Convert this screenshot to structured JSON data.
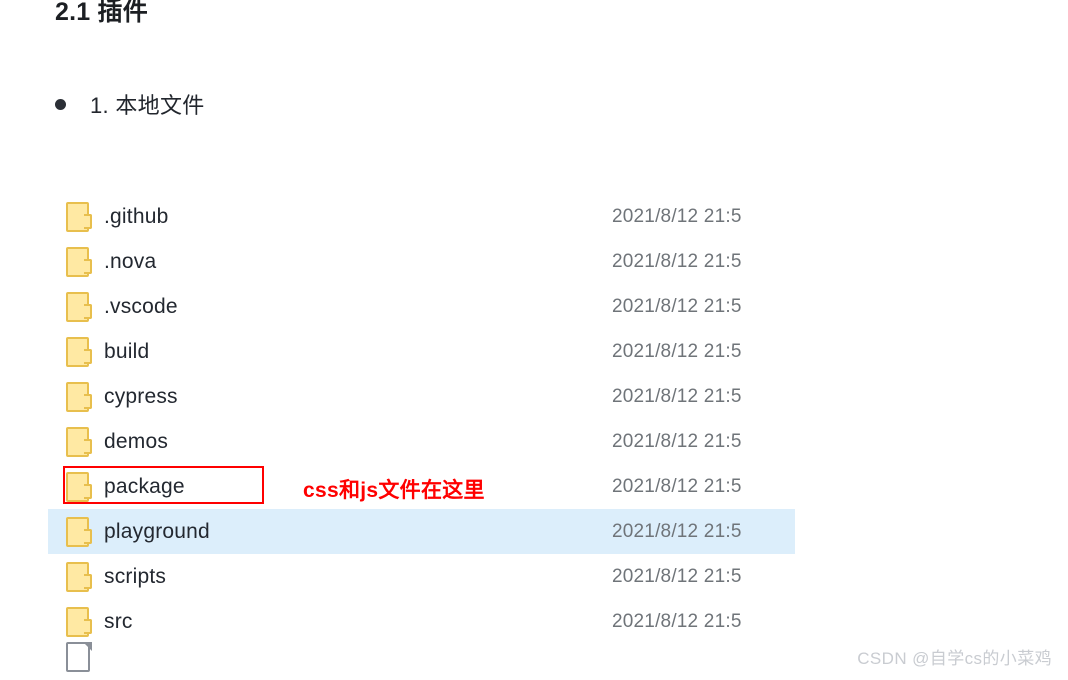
{
  "heading": {
    "title": "2.1 插件"
  },
  "bullet_list": {
    "items": [
      {
        "label": "1. 本地文件",
        "bullet": "filled-circle"
      }
    ]
  },
  "file_explorer": {
    "date_column_truncated": true,
    "rows": [
      {
        "icon": "folder-icon",
        "name": ".github",
        "date": "2021/8/12 21:5",
        "selected": false,
        "boxed": false
      },
      {
        "icon": "folder-icon",
        "name": ".nova",
        "date": "2021/8/12 21:5",
        "selected": false,
        "boxed": false
      },
      {
        "icon": "folder-icon",
        "name": ".vscode",
        "date": "2021/8/12 21:5",
        "selected": false,
        "boxed": false
      },
      {
        "icon": "folder-icon",
        "name": "build",
        "date": "2021/8/12 21:5",
        "selected": false,
        "boxed": false
      },
      {
        "icon": "folder-icon",
        "name": "cypress",
        "date": "2021/8/12 21:5",
        "selected": false,
        "boxed": false
      },
      {
        "icon": "folder-icon",
        "name": "demos",
        "date": "2021/8/12 21:5",
        "selected": false,
        "boxed": false
      },
      {
        "icon": "folder-icon",
        "name": "package",
        "date": "2021/8/12 21:5",
        "selected": false,
        "boxed": true
      },
      {
        "icon": "folder-icon",
        "name": "playground",
        "date": "2021/8/12 21:5",
        "selected": true,
        "boxed": false
      },
      {
        "icon": "folder-icon",
        "name": "scripts",
        "date": "2021/8/12 21:5",
        "selected": false,
        "boxed": false
      },
      {
        "icon": "folder-icon",
        "name": "src",
        "date": "2021/8/12 21:5",
        "selected": false,
        "boxed": false
      }
    ],
    "cut_off_row": {
      "icon": "document-icon",
      "name": "",
      "date": ""
    }
  },
  "annotations": [
    {
      "text": "css和js文件在这里",
      "color": "#ff0000",
      "target_row": "package"
    }
  ],
  "highlight": {
    "selection_color": "#dceefb",
    "box_color": "#ff0000"
  },
  "watermark": {
    "text": "CSDN @自学cs的小菜鸡"
  }
}
